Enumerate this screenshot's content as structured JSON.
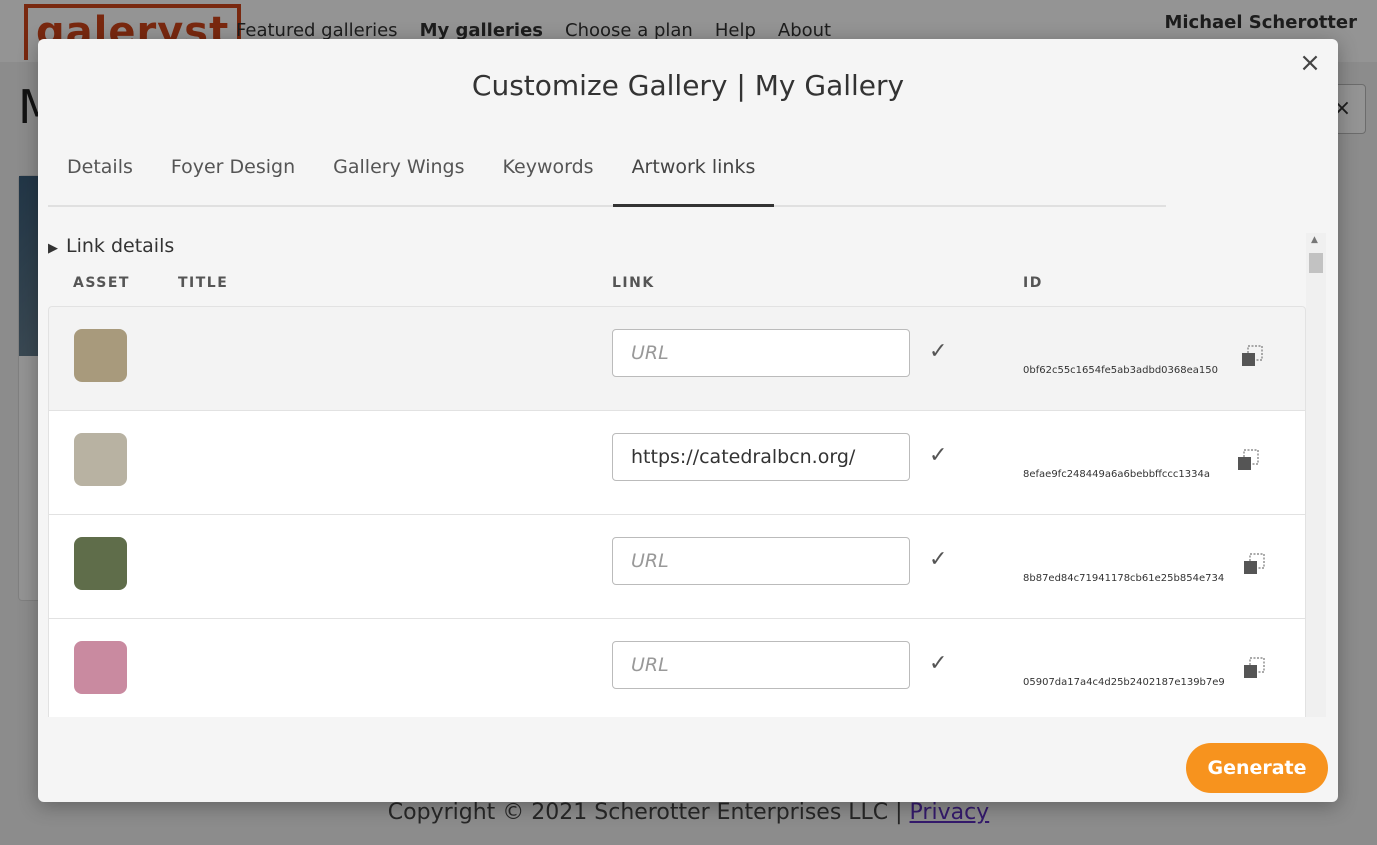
{
  "background": {
    "logo_text": "galeryst",
    "nav": [
      "Featured galleries",
      "My galleries",
      "Choose a plan",
      "Help",
      "About"
    ],
    "user_name": "Michael Scherotter",
    "heading": "M",
    "close_symbol": "×",
    "footer_copyright": "Copyright © 2021 Scherotter Enterprises LLC | ",
    "footer_privacy": "Privacy"
  },
  "modal": {
    "title": "Customize Gallery | My Gallery",
    "close_symbol": "×",
    "tabs": [
      "Details",
      "Foyer Design",
      "Gallery Wings",
      "Keywords",
      "Artwork links"
    ],
    "active_tab": "Artwork links",
    "details_toggle": "Link details",
    "columns": {
      "asset": "ASSET",
      "title": "TITLE",
      "link": "LINK",
      "id": "ID"
    },
    "rows": [
      {
        "title": "",
        "link": "",
        "placeholder": "URL",
        "id": "0bf62c55c1654fe5ab3adbd0368ea150",
        "thumb_color": "#a89a7c"
      },
      {
        "title": "",
        "link": "https://catedralbcn.org/",
        "placeholder": "URL",
        "id": "8efae9fc248449a6a6bebbffccc1334a",
        "thumb_color": "#b8b2a2"
      },
      {
        "title": "",
        "link": "",
        "placeholder": "URL",
        "id": "8b87ed84c71941178cb61e25b854e734",
        "thumb_color": "#5f6d4a"
      },
      {
        "title": "",
        "link": "",
        "placeholder": "URL",
        "id": "05907da17a4c4d25b2402187e139b7e9",
        "thumb_color": "#c98aa0"
      }
    ],
    "check_symbol": "✓",
    "generate_label": "Generate",
    "accent_color": "#f7931e"
  }
}
